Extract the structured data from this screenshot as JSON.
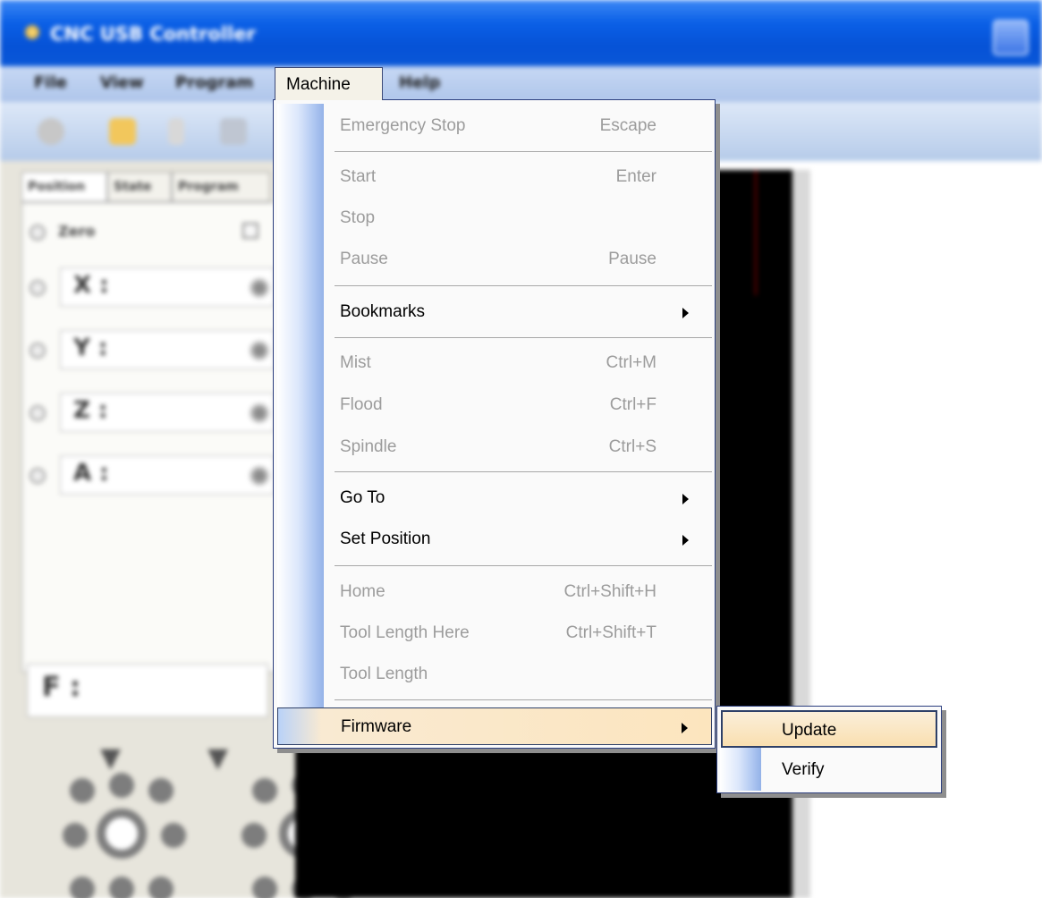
{
  "window": {
    "title": "CNC USB Controller"
  },
  "menubar": {
    "items": [
      "File",
      "View",
      "Program",
      "Machine",
      "Help"
    ]
  },
  "left_panel": {
    "tabs": [
      "Position",
      "State",
      "Program"
    ],
    "zero_label": "Zero",
    "axes": [
      "X :",
      "Y :",
      "Z :",
      "A :"
    ],
    "feed_label": "F :"
  },
  "machine_menu": {
    "title": "Machine",
    "items": [
      {
        "label": "Emergency Stop",
        "shortcut": "Escape",
        "enabled": false
      },
      {
        "label": "Start",
        "shortcut": "Enter",
        "enabled": false
      },
      {
        "label": "Stop",
        "shortcut": "",
        "enabled": false
      },
      {
        "label": "Pause",
        "shortcut": "Pause",
        "enabled": false
      },
      {
        "label": "Bookmarks",
        "shortcut": "",
        "enabled": true,
        "submenu": true
      },
      {
        "label": "Mist",
        "shortcut": "Ctrl+M",
        "enabled": false
      },
      {
        "label": "Flood",
        "shortcut": "Ctrl+F",
        "enabled": false
      },
      {
        "label": "Spindle",
        "shortcut": "Ctrl+S",
        "enabled": false
      },
      {
        "label": "Go To",
        "shortcut": "",
        "enabled": true,
        "submenu": true
      },
      {
        "label": "Set Position",
        "shortcut": "",
        "enabled": true,
        "submenu": true
      },
      {
        "label": "Home",
        "shortcut": "Ctrl+Shift+H",
        "enabled": false
      },
      {
        "label": "Tool Length Here",
        "shortcut": "Ctrl+Shift+T",
        "enabled": false
      },
      {
        "label": "Tool Length",
        "shortcut": "",
        "enabled": false
      },
      {
        "label": "Firmware",
        "shortcut": "",
        "enabled": true,
        "submenu": true,
        "highlighted": true
      }
    ]
  },
  "firmware_submenu": {
    "items": [
      {
        "label": "Update",
        "highlighted": true
      },
      {
        "label": "Verify",
        "highlighted": false
      }
    ]
  },
  "colors": {
    "titlebar": "#0652d6",
    "menu_highlight": "#fce5be",
    "disabled_text": "#9c9c9c",
    "menu_border": "#2b3e7e"
  }
}
